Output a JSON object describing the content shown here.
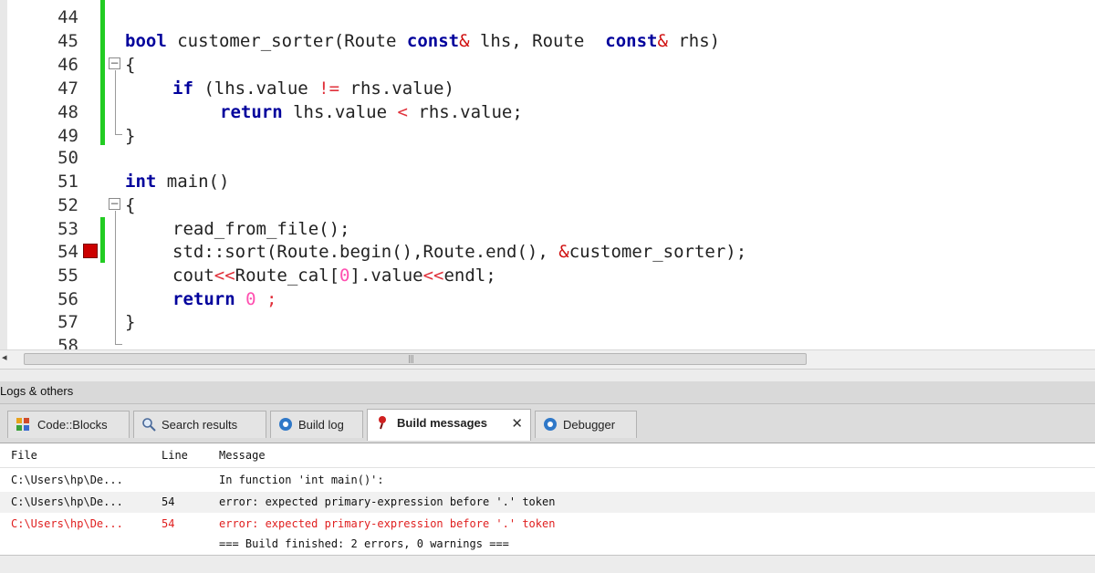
{
  "editor": {
    "lines": [
      {
        "num": "44"
      },
      {
        "num": "45"
      },
      {
        "num": "46"
      },
      {
        "num": "47"
      },
      {
        "num": "48"
      },
      {
        "num": "49"
      },
      {
        "num": "50"
      },
      {
        "num": "51"
      },
      {
        "num": "52"
      },
      {
        "num": "53"
      },
      {
        "num": "54"
      },
      {
        "num": "55"
      },
      {
        "num": "56"
      },
      {
        "num": "57"
      },
      {
        "num": "58"
      }
    ],
    "code": {
      "l45_kw": "bool",
      "l45_a": " customer_sorter(Route ",
      "l45_kw2": "const",
      "l45_amp": "&",
      "l45_b": " lhs, Route  ",
      "l45_kw3": "const",
      "l45_amp2": "&",
      "l45_c": " rhs)",
      "l46": "{",
      "l47_kw": "if",
      "l47_a": " (lhs.value ",
      "l47_op": "!=",
      "l47_b": " rhs.value)",
      "l48_kw": "return",
      "l48_a": " lhs.value ",
      "l48_op": "<",
      "l48_b": " rhs.value;",
      "l49": "}",
      "l51_kw": "int",
      "l51_a": " main()",
      "l52": "{",
      "l53": "read_from_file();",
      "l54_a": "std::sort(Route.begin(),Route.end(), ",
      "l54_amp": "&",
      "l54_b": "customer_sorter);",
      "l55_a": "cout",
      "l55_op": "<<",
      "l55_b": "Route_cal[",
      "l55_num": "0",
      "l55_c": "].value",
      "l55_op2": "<<",
      "l55_d": "endl;",
      "l56_kw": "return",
      "l56_num": " 0",
      "l56_semi": " ;",
      "l57": "}"
    },
    "colors": {
      "keyword": "#00009c",
      "operator": "#e0303a",
      "number": "#ff4fb0",
      "breakpoint": "#cc0000",
      "changebar": "#22cc22"
    }
  },
  "panel": {
    "title": "Logs & others",
    "tabs": [
      {
        "label": "Code::Blocks",
        "icon": "codeblocks-icon"
      },
      {
        "label": "Search results",
        "icon": "search-icon"
      },
      {
        "label": "Build log",
        "icon": "gear-icon"
      },
      {
        "label": "Build messages",
        "icon": "pin-icon",
        "close": "✕"
      },
      {
        "label": "Debugger",
        "icon": "gear-icon"
      }
    ],
    "columns": {
      "file": "File",
      "line": "Line",
      "message": "Message"
    },
    "rows": [
      {
        "file": "C:\\Users\\hp\\De...",
        "line": "",
        "message": "In function 'int main()':"
      },
      {
        "file": "C:\\Users\\hp\\De...",
        "line": "54",
        "message": "error: expected primary-expression before '.' token"
      },
      {
        "file": "C:\\Users\\hp\\De...",
        "line": "54",
        "message": "error: expected primary-expression before '.' token"
      },
      {
        "file": "",
        "line": "",
        "message": "=== Build finished: 2 errors, 0 warnings ==="
      }
    ]
  },
  "scrollbar": {
    "left_arrow": "◂",
    "grip": "|||"
  }
}
